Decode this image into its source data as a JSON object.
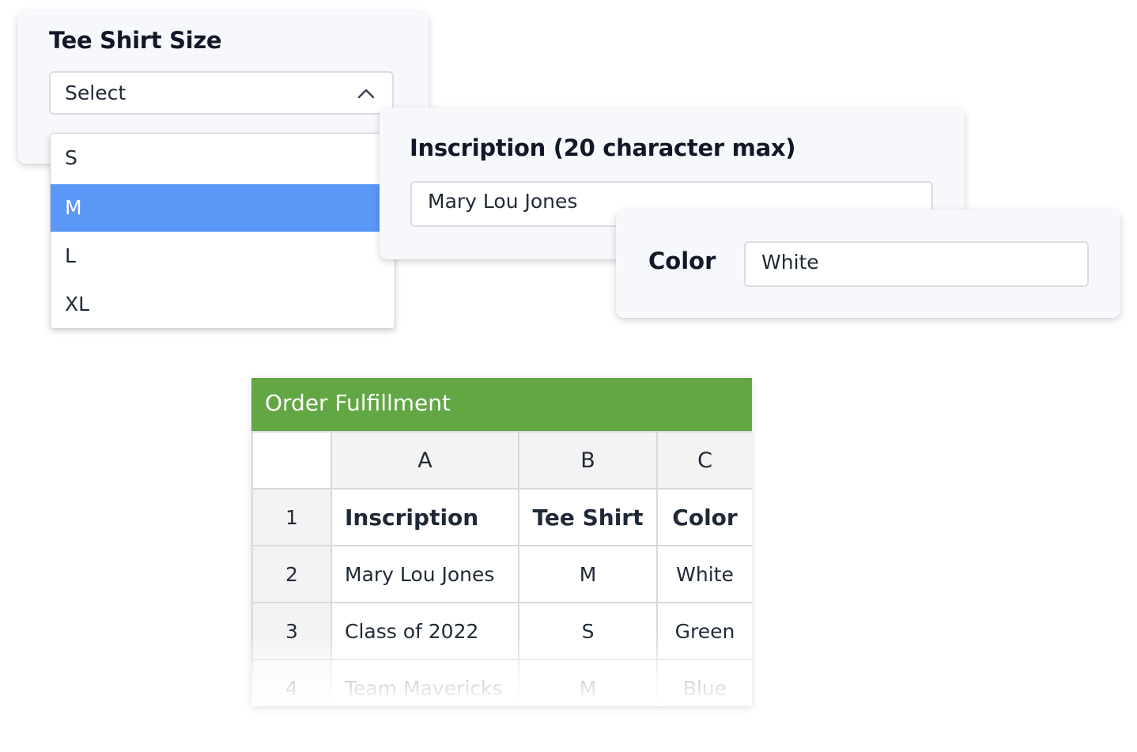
{
  "tee_card": {
    "title": "Tee Shirt Size",
    "select_value": "Select",
    "options": [
      "S",
      "M",
      "L",
      "XL"
    ],
    "highlighted_option": "M"
  },
  "inscription_card": {
    "title": "Inscription (20 character max)",
    "value": "Mary Lou Jones"
  },
  "color_card": {
    "label": "Color",
    "value": "White"
  },
  "sheet": {
    "title": "Order Fulfillment",
    "columns": [
      "A",
      "B",
      "C"
    ],
    "rows": [
      {
        "num": "1",
        "cells": [
          "Inscription",
          "Tee Shirt",
          "Color"
        ]
      },
      {
        "num": "2",
        "cells": [
          "Mary Lou Jones",
          "M",
          "White"
        ]
      },
      {
        "num": "3",
        "cells": [
          "Class of 2022",
          "S",
          "Green"
        ]
      },
      {
        "num": "4",
        "cells": [
          "Team Mavericks",
          "M",
          "Blue"
        ]
      }
    ],
    "header_color": "#62a744"
  },
  "colors": {
    "selected_option": "#5b97f6",
    "card_background": "#f7f8fb"
  },
  "icons": {
    "select_chevron": "chevron-up-icon"
  }
}
